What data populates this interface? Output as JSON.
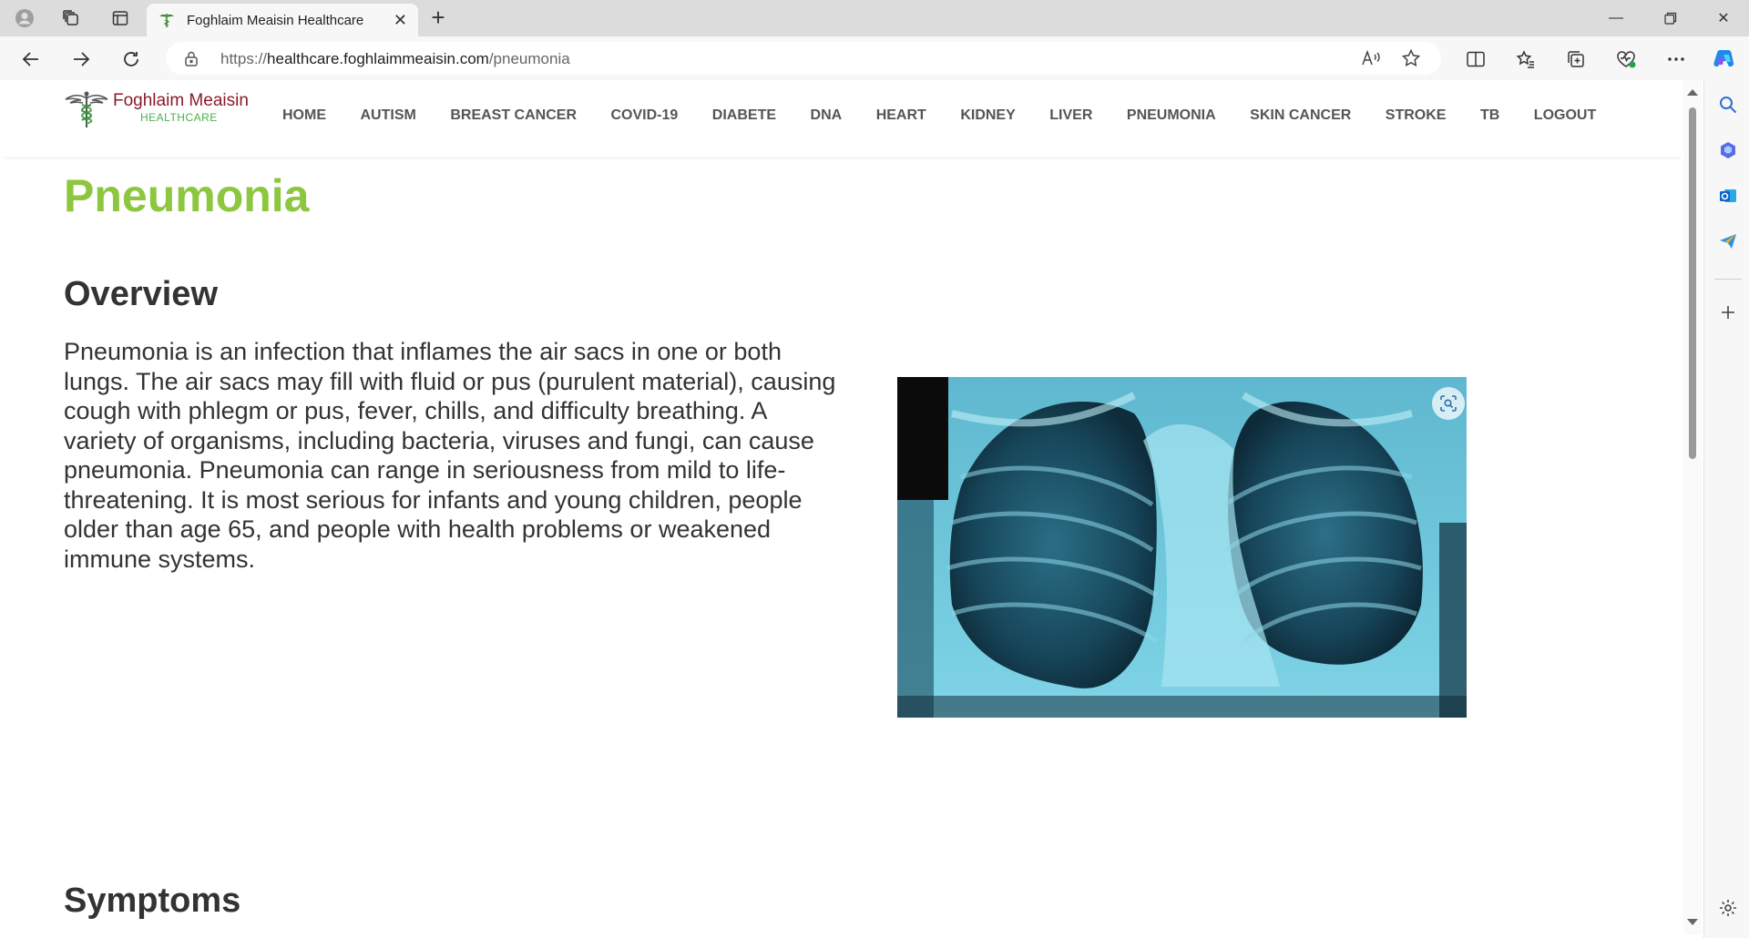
{
  "browser": {
    "tab": {
      "title": "Foghlaim Meaisin Healthcare"
    },
    "address": {
      "url_scheme": "https://",
      "url_host": "healthcare.foghlaimmeaisin.com",
      "url_path": "/pneumonia"
    }
  },
  "site": {
    "logo": {
      "name": "Foghlaim Meaisin",
      "sub": "HEALTHCARE"
    },
    "menu": [
      "HOME",
      "AUTISM",
      "BREAST CANCER",
      "COVID-19",
      "DIABETE",
      "DNA",
      "HEART",
      "KIDNEY",
      "LIVER",
      "PNEUMONIA",
      "SKIN CANCER",
      "STROKE",
      "TB",
      "LOGOUT"
    ]
  },
  "content": {
    "title": "Pneumonia",
    "overview_heading": "Overview",
    "overview_text": "Pneumonia is an infection that inflames the air sacs in one or both lungs. The air sacs may fill with fluid or pus (purulent material), causing cough with phlegm or pus, fever, chills, and difficulty breathing. A variety of organisms, including bacteria, viruses and fungi, can cause pneumonia. Pneumonia can range in seriousness from mild to life-threatening. It is most serious for infants and young children, people older than age 65, and people with health problems or weakened immune systems.",
    "symptoms_heading": "Symptoms"
  },
  "colors": {
    "title_green": "#8dc63f",
    "logo_red": "#8b1a2b",
    "logo_green": "#4caf50",
    "xray_cyan": "#7fd4e6"
  },
  "icons": [
    "profile-icon",
    "workspaces-icon",
    "tab-actions-icon",
    "back-icon",
    "forward-icon",
    "refresh-icon",
    "lock-icon",
    "read-aloud-icon",
    "favorite-star-icon",
    "split-screen-icon",
    "favorites-icon",
    "collections-icon",
    "browser-essentials-icon",
    "more-icon",
    "copilot-icon",
    "sidebar-search-icon",
    "sidebar-copilot-icon",
    "sidebar-outlook-icon",
    "sidebar-send-icon",
    "sidebar-add-icon",
    "sidebar-settings-icon",
    "visual-search-icon"
  ]
}
